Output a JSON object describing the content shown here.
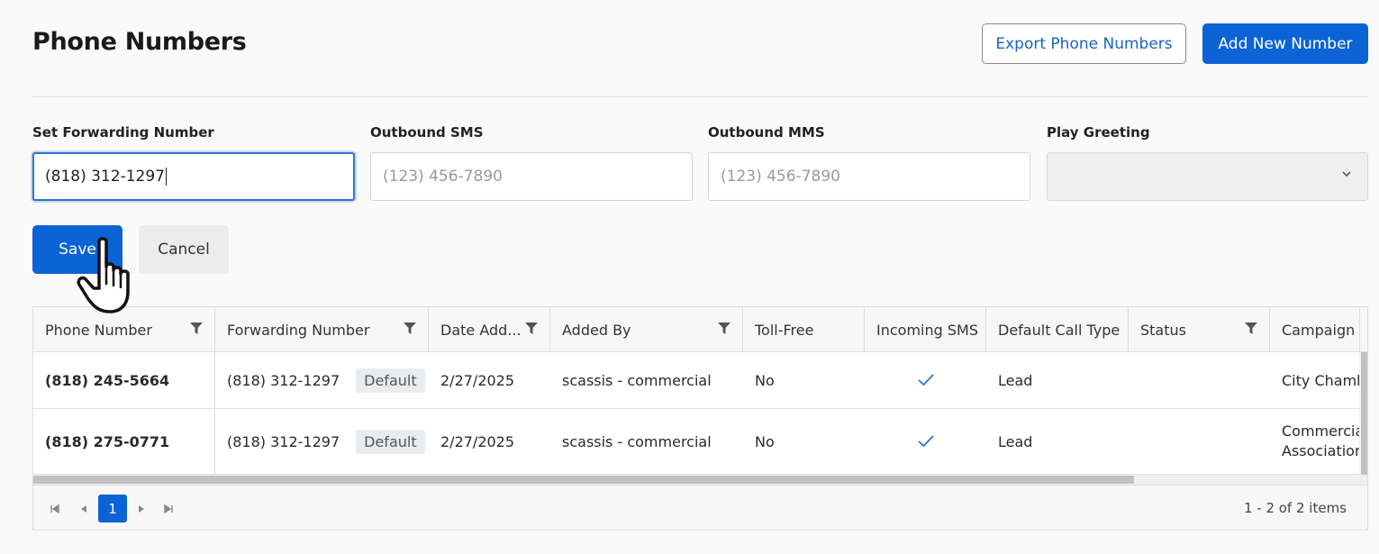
{
  "page": {
    "title": "Phone Numbers",
    "export_label": "Export Phone Numbers",
    "add_label": "Add New Number"
  },
  "form": {
    "forwarding": {
      "label": "Set Forwarding Number",
      "value": "(818) 312-1297"
    },
    "outbound_sms": {
      "label": "Outbound SMS",
      "placeholder": "(123) 456-7890"
    },
    "outbound_mms": {
      "label": "Outbound MMS",
      "placeholder": "(123) 456-7890"
    },
    "play_greeting": {
      "label": "Play Greeting",
      "value": ""
    },
    "save_label": "Save",
    "cancel_label": "Cancel"
  },
  "table": {
    "columns": [
      "Phone Number",
      "Forwarding Number",
      "Date Add...",
      "Added By",
      "Toll-Free",
      "Incoming SMS",
      "Default Call Type",
      "Status",
      "Campaign"
    ],
    "rows": [
      {
        "phone": "(818) 245-5664",
        "forwarding": "(818) 312-1297",
        "badge": "Default",
        "date": "2/27/2025",
        "added_by": "scassis - commercial",
        "toll_free": "No",
        "incoming_sms": true,
        "call_type": "Lead",
        "status": "",
        "campaign": "City Chambe"
      },
      {
        "phone": "(818) 275-0771",
        "forwarding": "(818) 312-1297",
        "badge": "Default",
        "date": "2/27/2025",
        "added_by": "scassis - commercial",
        "toll_free": "No",
        "incoming_sms": true,
        "call_type": "Lead",
        "status": "",
        "campaign": "Commercial Association"
      }
    ]
  },
  "pager": {
    "current_page": "1",
    "info": "1 - 2 of 2 items"
  },
  "colors": {
    "primary": "#0b63d6",
    "link": "#1565c0",
    "check": "#2f74d0"
  }
}
